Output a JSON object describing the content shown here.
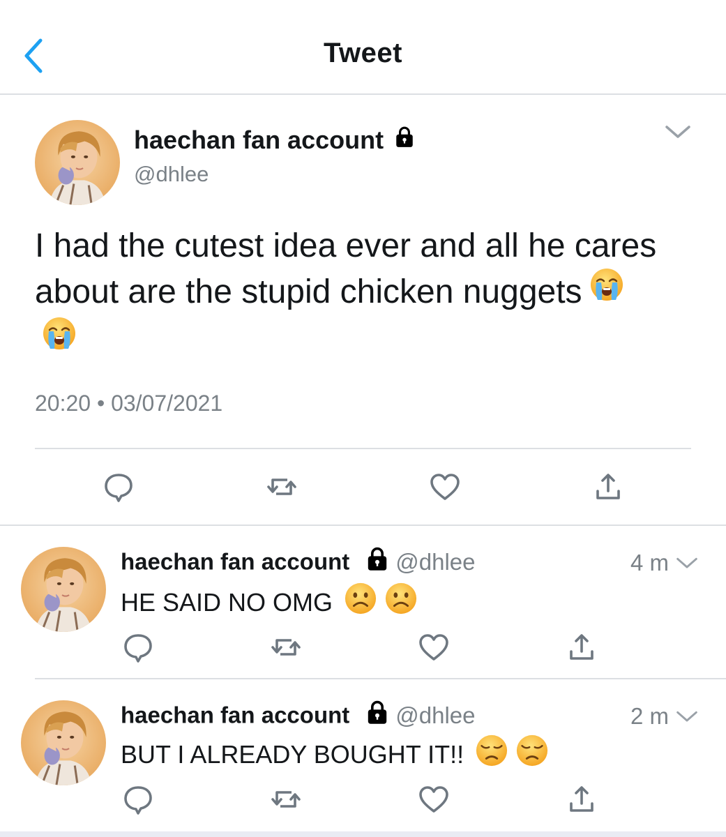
{
  "nav": {
    "title": "Tweet",
    "back_icon": "chevron-left-icon"
  },
  "colors": {
    "accent": "#1da1f2",
    "text": "#14171a",
    "secondary": "#7a8187",
    "divider": "#dcdfe3"
  },
  "main_tweet": {
    "display_name": "haechan fan account",
    "handle": "@dhlee",
    "protected_icon": "lock-icon",
    "text": "I had the cutest idea ever and all he cares about are the stupid chicken nuggets",
    "emoji": [
      "loudly-crying-face",
      "loudly-crying-face"
    ],
    "timestamp": "20:20 • 03/07/2021",
    "actions": [
      "reply-icon",
      "retweet-icon",
      "like-icon",
      "share-icon"
    ]
  },
  "replies": [
    {
      "display_name": "haechan fan account",
      "handle": "@dhlee",
      "time": "4 m",
      "text": "HE SAID NO OMG",
      "emoji": [
        "frowning-face",
        "frowning-face"
      ]
    },
    {
      "display_name": "haechan fan account",
      "handle": "@dhlee",
      "time": "2 m",
      "text": "BUT I ALREADY BOUGHT IT!!",
      "emoji": [
        "disappointed-face",
        "disappointed-face"
      ]
    }
  ]
}
